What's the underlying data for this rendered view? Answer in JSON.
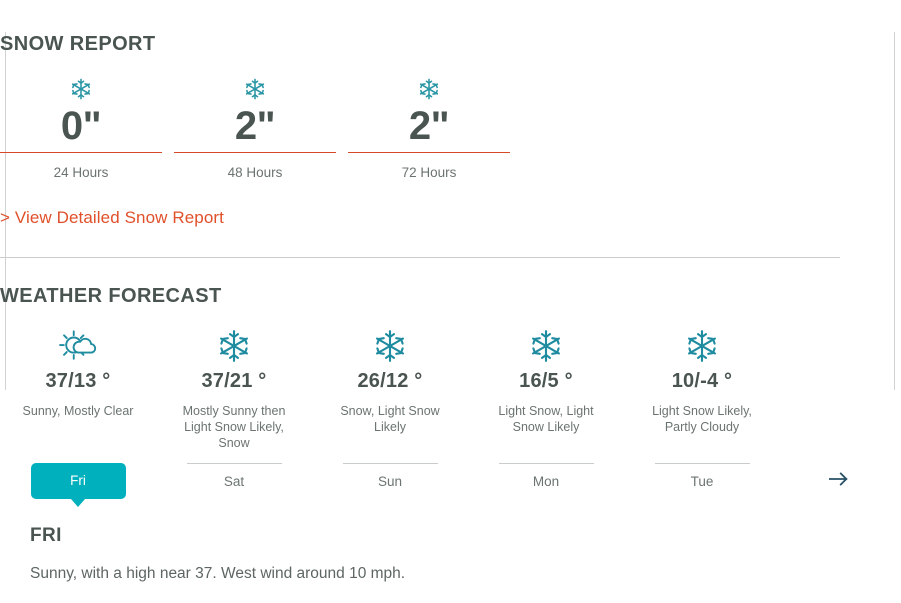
{
  "snow_report": {
    "title": "SNOW REPORT",
    "accent_color": "#d64a28",
    "icon_color": "#2a96a5",
    "cards": [
      {
        "icon": "snowflake-icon",
        "depth": "0\"",
        "period": "24 Hours"
      },
      {
        "icon": "snowflake-icon",
        "depth": "2\"",
        "period": "48 Hours"
      },
      {
        "icon": "snowflake-icon",
        "depth": "2\"",
        "period": "72 Hours"
      }
    ],
    "detail_link": "> View Detailed Snow Report"
  },
  "weather_forecast": {
    "title": "WEATHER FORECAST",
    "active_color": "#00b0bd",
    "icon_color": "#1f8ca0",
    "next_arrow_icon": "arrow-right-icon",
    "days": [
      {
        "icon": "sun-behind-cloud-icon",
        "temps": "37/13 °",
        "conditions": "Sunny, Mostly Clear",
        "label": "Fri",
        "active": true
      },
      {
        "icon": "snowflake-icon",
        "temps": "37/21 °",
        "conditions": "Mostly Sunny then Light Snow Likely, Snow",
        "label": "Sat",
        "active": false
      },
      {
        "icon": "snowflake-icon",
        "temps": "26/12 °",
        "conditions": "Snow, Light Snow Likely",
        "label": "Sun",
        "active": false
      },
      {
        "icon": "snowflake-icon",
        "temps": "16/5 °",
        "conditions": "Light Snow, Light Snow Likely",
        "label": "Mon",
        "active": false
      },
      {
        "icon": "snowflake-icon",
        "temps": "10/-4 °",
        "conditions": "Light Snow Likely, Partly Cloudy",
        "label": "Tue",
        "active": false
      }
    ]
  },
  "forecast_detail": {
    "day": "FRI",
    "text": "Sunny, with a high near 37. West wind around 10 mph."
  }
}
